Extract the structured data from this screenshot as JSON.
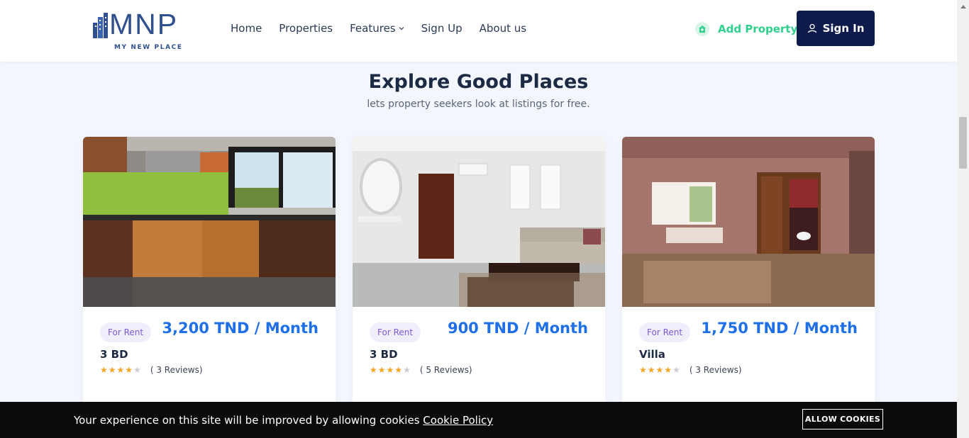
{
  "brand": {
    "name": "MNP",
    "tagline": "MY NEW PLACE"
  },
  "nav": {
    "items": [
      {
        "label": "Home"
      },
      {
        "label": "Properties"
      },
      {
        "label": "Features",
        "has_dropdown": true
      },
      {
        "label": "Sign Up"
      },
      {
        "label": "About us"
      }
    ]
  },
  "header": {
    "add_property": "Add Property",
    "sign_in": "Sign In"
  },
  "section": {
    "title": "Explore Good Places",
    "subtitle": "lets property seekers look at listings for free."
  },
  "listings": [
    {
      "badge": "For Rent",
      "price": "3,200 TND / Month",
      "type": "3 BD",
      "rating": 4,
      "max_rating": 5,
      "reviews": "( 3 Reviews)",
      "photo": "kitchen"
    },
    {
      "badge": "For Rent",
      "price": "900 TND / Month",
      "type": "3 BD",
      "rating": 4,
      "max_rating": 5,
      "reviews": "( 5 Reviews)",
      "photo": "living-room"
    },
    {
      "badge": "For Rent",
      "price": "1,750 TND / Month",
      "type": "Villa",
      "rating": 4,
      "max_rating": 5,
      "reviews": "( 3 Reviews)",
      "photo": "villa-room"
    }
  ],
  "cookie": {
    "message": "Your experience on this site will be improved by allowing cookies",
    "link": "Cookie Policy",
    "button": "ALLOW COOKIES"
  },
  "colors": {
    "brand_navy": "#0d1b4c",
    "accent_green": "#2fd08d",
    "price_blue": "#1f6fe8",
    "badge_purple": "#7c5cd6",
    "star": "#f5a623"
  }
}
